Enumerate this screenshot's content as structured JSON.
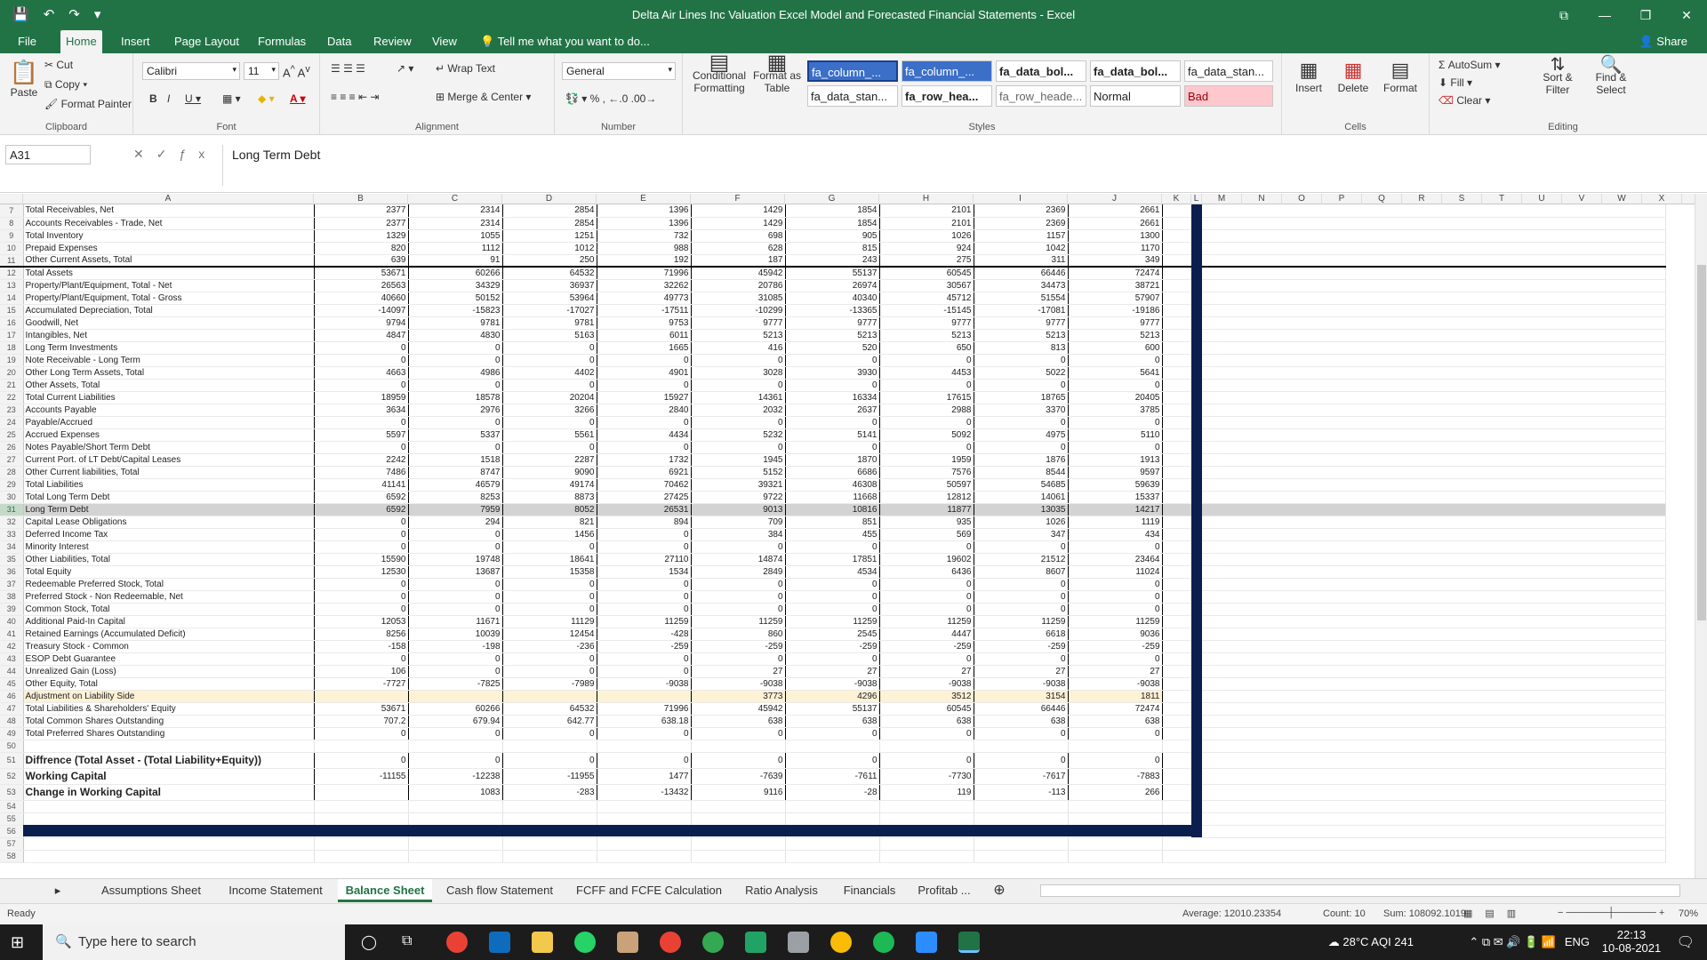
{
  "window": {
    "title": "Delta Air Lines Inc Valuation Excel Model and Forecasted Financial Statements - Excel",
    "buttons": [
      "⧉",
      "—",
      "❐",
      "✕"
    ]
  },
  "menu": {
    "tabs": [
      "File",
      "Home",
      "Insert",
      "Page Layout",
      "Formulas",
      "Data",
      "Review",
      "View"
    ],
    "tell_me": "Tell me what you want to do...",
    "share": "Share"
  },
  "ribbon": {
    "clipboard": {
      "label": "Clipboard",
      "paste": "Paste",
      "cut": "Cut",
      "copy": "Copy",
      "format_painter": "Format Painter"
    },
    "font": {
      "label": "Font",
      "name": "Calibri",
      "size": "11"
    },
    "alignment": {
      "label": "Alignment",
      "wrap": "Wrap Text",
      "merge": "Merge & Center"
    },
    "number": {
      "label": "Number",
      "format": "General"
    },
    "styles": {
      "label": "Styles",
      "conditional": "Conditional Formatting",
      "format_table": "Format as Table",
      "cells": [
        "fa_column_...",
        "fa_column_...",
        "fa_data_bol...",
        "fa_data_bol...",
        "fa_data_stan...",
        "fa_data_stan...",
        "fa_row_hea...",
        "fa_row_heade...",
        "Normal",
        "Bad"
      ]
    },
    "cells": {
      "label": "Cells",
      "insert": "Insert",
      "delete": "Delete",
      "format": "Format"
    },
    "editing": {
      "label": "Editing",
      "autosum": "AutoSum",
      "fill": "Fill",
      "clear": "Clear",
      "sort": "Sort & Filter",
      "find": "Find & Select"
    }
  },
  "formula_bar": {
    "name_box": "A31",
    "content": "Long Term Debt"
  },
  "columns": [
    "A",
    "B",
    "C",
    "D",
    "E",
    "F",
    "G",
    "H",
    "I",
    "J",
    "K",
    "L",
    "M",
    "N",
    "O",
    "P",
    "Q",
    "R",
    "S",
    "T",
    "U",
    "V",
    "W",
    "X"
  ],
  "rows": [
    {
      "n": "7",
      "label": "Total Receivables, Net",
      "v": [
        "2377",
        "2314",
        "2854",
        "1396",
        "1429",
        "1854",
        "2101",
        "2369",
        "2661"
      ]
    },
    {
      "n": "8",
      "label": "Accounts Receivables - Trade, Net",
      "v": [
        "2377",
        "2314",
        "2854",
        "1396",
        "1429",
        "1854",
        "2101",
        "2369",
        "2661"
      ]
    },
    {
      "n": "9",
      "label": "Total Inventory",
      "v": [
        "1329",
        "1055",
        "1251",
        "732",
        "698",
        "905",
        "1026",
        "1157",
        "1300"
      ]
    },
    {
      "n": "10",
      "label": "Prepaid Expenses",
      "v": [
        "820",
        "1112",
        "1012",
        "988",
        "628",
        "815",
        "924",
        "1042",
        "1170"
      ]
    },
    {
      "n": "11",
      "label": "Other Current Assets, Total",
      "v": [
        "639",
        "91",
        "250",
        "192",
        "187",
        "243",
        "275",
        "311",
        "349"
      ]
    },
    {
      "n": "12",
      "label": "Total Assets",
      "v": [
        "53671",
        "60266",
        "64532",
        "71996",
        "45942",
        "55137",
        "60545",
        "66446",
        "72474"
      ],
      "style": "thick"
    },
    {
      "n": "13",
      "label": "Property/Plant/Equipment, Total - Net",
      "v": [
        "26563",
        "34329",
        "36937",
        "32262",
        "20786",
        "26974",
        "30567",
        "34473",
        "38721"
      ]
    },
    {
      "n": "14",
      "label": "Property/Plant/Equipment, Total - Gross",
      "v": [
        "40660",
        "50152",
        "53964",
        "49773",
        "31085",
        "40340",
        "45712",
        "51554",
        "57907"
      ]
    },
    {
      "n": "15",
      "label": "Accumulated Depreciation, Total",
      "v": [
        "-14097",
        "-15823",
        "-17027",
        "-17511",
        "-10299",
        "-13365",
        "-15145",
        "-17081",
        "-19186"
      ]
    },
    {
      "n": "16",
      "label": "Goodwill, Net",
      "v": [
        "9794",
        "9781",
        "9781",
        "9753",
        "9777",
        "9777",
        "9777",
        "9777",
        "9777"
      ]
    },
    {
      "n": "17",
      "label": "Intangibles, Net",
      "v": [
        "4847",
        "4830",
        "5163",
        "6011",
        "5213",
        "5213",
        "5213",
        "5213",
        "5213"
      ]
    },
    {
      "n": "18",
      "label": "Long Term Investments",
      "v": [
        "0",
        "0",
        "0",
        "1665",
        "416",
        "520",
        "650",
        "813",
        "600"
      ]
    },
    {
      "n": "19",
      "label": "Note Receivable - Long Term",
      "v": [
        "0",
        "0",
        "0",
        "0",
        "0",
        "0",
        "0",
        "0",
        "0"
      ]
    },
    {
      "n": "20",
      "label": "Other Long Term Assets, Total",
      "v": [
        "4663",
        "4986",
        "4402",
        "4901",
        "3028",
        "3930",
        "4453",
        "5022",
        "5641"
      ]
    },
    {
      "n": "21",
      "label": "Other Assets, Total",
      "v": [
        "0",
        "0",
        "0",
        "0",
        "0",
        "0",
        "0",
        "0",
        "0"
      ]
    },
    {
      "n": "22",
      "label": "Total Current Liabilities",
      "v": [
        "18959",
        "18578",
        "20204",
        "15927",
        "14361",
        "16334",
        "17615",
        "18765",
        "20405"
      ]
    },
    {
      "n": "23",
      "label": "Accounts Payable",
      "v": [
        "3634",
        "2976",
        "3266",
        "2840",
        "2032",
        "2637",
        "2988",
        "3370",
        "3785"
      ]
    },
    {
      "n": "24",
      "label": "Payable/Accrued",
      "v": [
        "0",
        "0",
        "0",
        "0",
        "0",
        "0",
        "0",
        "0",
        "0"
      ]
    },
    {
      "n": "25",
      "label": "Accrued Expenses",
      "v": [
        "5597",
        "5337",
        "5561",
        "4434",
        "5232",
        "5141",
        "5092",
        "4975",
        "5110"
      ]
    },
    {
      "n": "26",
      "label": "Notes Payable/Short Term Debt",
      "v": [
        "0",
        "0",
        "0",
        "0",
        "0",
        "0",
        "0",
        "0",
        "0"
      ]
    },
    {
      "n": "27",
      "label": "Current Port. of LT Debt/Capital Leases",
      "v": [
        "2242",
        "1518",
        "2287",
        "1732",
        "1945",
        "1870",
        "1959",
        "1876",
        "1913"
      ]
    },
    {
      "n": "28",
      "label": "Other Current liabilities, Total",
      "v": [
        "7486",
        "8747",
        "9090",
        "6921",
        "5152",
        "6686",
        "7576",
        "8544",
        "9597"
      ]
    },
    {
      "n": "29",
      "label": "Total Liabilities",
      "v": [
        "41141",
        "46579",
        "49174",
        "70462",
        "39321",
        "46308",
        "50597",
        "54685",
        "59639"
      ]
    },
    {
      "n": "30",
      "label": "Total Long Term Debt",
      "v": [
        "6592",
        "8253",
        "8873",
        "27425",
        "9722",
        "11668",
        "12812",
        "14061",
        "15337"
      ]
    },
    {
      "n": "31",
      "label": "Long Term Debt",
      "v": [
        "6592",
        "7959",
        "8052",
        "26531",
        "9013",
        "10816",
        "11877",
        "13035",
        "14217"
      ],
      "style": "sel"
    },
    {
      "n": "32",
      "label": "Capital Lease Obligations",
      "v": [
        "0",
        "294",
        "821",
        "894",
        "709",
        "851",
        "935",
        "1026",
        "1119"
      ]
    },
    {
      "n": "33",
      "label": "Deferred Income Tax",
      "v": [
        "0",
        "0",
        "1456",
        "0",
        "384",
        "455",
        "569",
        "347",
        "434"
      ]
    },
    {
      "n": "34",
      "label": "Minority Interest",
      "v": [
        "0",
        "0",
        "0",
        "0",
        "0",
        "0",
        "0",
        "0",
        "0"
      ]
    },
    {
      "n": "35",
      "label": "Other Liabilities, Total",
      "v": [
        "15590",
        "19748",
        "18641",
        "27110",
        "14874",
        "17851",
        "19602",
        "21512",
        "23464"
      ]
    },
    {
      "n": "36",
      "label": "Total Equity",
      "v": [
        "12530",
        "13687",
        "15358",
        "1534",
        "2849",
        "4534",
        "6436",
        "8607",
        "11024"
      ]
    },
    {
      "n": "37",
      "label": "Redeemable Preferred Stock, Total",
      "v": [
        "0",
        "0",
        "0",
        "0",
        "0",
        "0",
        "0",
        "0",
        "0"
      ]
    },
    {
      "n": "38",
      "label": "Preferred Stock - Non Redeemable, Net",
      "v": [
        "0",
        "0",
        "0",
        "0",
        "0",
        "0",
        "0",
        "0",
        "0"
      ]
    },
    {
      "n": "39",
      "label": "Common Stock, Total",
      "v": [
        "0",
        "0",
        "0",
        "0",
        "0",
        "0",
        "0",
        "0",
        "0"
      ]
    },
    {
      "n": "40",
      "label": "Additional Paid-In Capital",
      "v": [
        "12053",
        "11671",
        "11129",
        "11259",
        "11259",
        "11259",
        "11259",
        "11259",
        "11259"
      ]
    },
    {
      "n": "41",
      "label": "Retained Earnings (Accumulated Deficit)",
      "v": [
        "8256",
        "10039",
        "12454",
        "-428",
        "860",
        "2545",
        "4447",
        "6618",
        "9036"
      ]
    },
    {
      "n": "42",
      "label": "Treasury Stock - Common",
      "v": [
        "-158",
        "-198",
        "-236",
        "-259",
        "-259",
        "-259",
        "-259",
        "-259",
        "-259"
      ]
    },
    {
      "n": "43",
      "label": "ESOP Debt Guarantee",
      "v": [
        "0",
        "0",
        "0",
        "0",
        "0",
        "0",
        "0",
        "0",
        "0"
      ]
    },
    {
      "n": "44",
      "label": "Unrealized Gain (Loss)",
      "v": [
        "106",
        "0",
        "0",
        "0",
        "27",
        "27",
        "27",
        "27",
        "27"
      ]
    },
    {
      "n": "45",
      "label": "Other Equity, Total",
      "v": [
        "-7727",
        "-7825",
        "-7989",
        "-9038",
        "-9038",
        "-9038",
        "-9038",
        "-9038",
        "-9038"
      ]
    },
    {
      "n": "46",
      "label": "Adjustment on Liability Side",
      "v": [
        "",
        "",
        "",
        "",
        "3773",
        "4296",
        "3512",
        "3154",
        "1811"
      ],
      "style": "hl"
    },
    {
      "n": "47",
      "label": "Total Liabilities & Shareholders' Equity",
      "v": [
        "53671",
        "60266",
        "64532",
        "71996",
        "45942",
        "55137",
        "60545",
        "66446",
        "72474"
      ]
    },
    {
      "n": "48",
      "label": "Total Common Shares Outstanding",
      "v": [
        "707.2",
        "679.94",
        "642.77",
        "638.18",
        "638",
        "638",
        "638",
        "638",
        "638"
      ]
    },
    {
      "n": "49",
      "label": "Total Preferred Shares Outstanding",
      "v": [
        "0",
        "0",
        "0",
        "0",
        "0",
        "0",
        "0",
        "0",
        "0"
      ]
    },
    {
      "n": "50",
      "label": "",
      "v": [
        "",
        "",
        "",
        "",
        "",
        "",
        "",
        "",
        ""
      ],
      "style": "blank"
    },
    {
      "n": "51",
      "label": "Diffrence (Total Asset - (Total Liability+Equity))",
      "v": [
        "0",
        "0",
        "0",
        "0",
        "0",
        "0",
        "0",
        "0",
        "0"
      ],
      "style": "bold"
    },
    {
      "n": "52",
      "label": "Working Capital",
      "v": [
        "-11155",
        "-12238",
        "-11955",
        "1477",
        "-7639",
        "-7611",
        "-7730",
        "-7617",
        "-7883"
      ],
      "style": "bold"
    },
    {
      "n": "53",
      "label": "Change in Working Capital",
      "v": [
        "",
        "1083",
        "-283",
        "-13432",
        "9116",
        "-28",
        "119",
        "-113",
        "266"
      ],
      "style": "bold"
    },
    {
      "n": "54",
      "label": "",
      "v": [
        "",
        "",
        "",
        "",
        "",
        "",
        "",
        "",
        ""
      ],
      "style": "blank"
    },
    {
      "n": "55",
      "label": "",
      "v": [
        "",
        "",
        "",
        "",
        "",
        "",
        "",
        "",
        ""
      ],
      "style": "blank"
    },
    {
      "n": "56",
      "label": "",
      "v": [
        "",
        "",
        "",
        "",
        "",
        "",
        "",
        "",
        ""
      ],
      "style": "blank"
    },
    {
      "n": "57",
      "label": "",
      "v": [
        "",
        "",
        "",
        "",
        "",
        "",
        "",
        "",
        ""
      ],
      "style": "blank"
    },
    {
      "n": "58",
      "label": "",
      "v": [
        "",
        "",
        "",
        "",
        "",
        "",
        "",
        "",
        ""
      ],
      "style": "blank"
    }
  ],
  "sheet_tabs": [
    "Assumptions Sheet",
    "Income Statement",
    "Balance Sheet",
    "Cash flow Statement",
    "FCFF and FCFE Calculation",
    "Ratio Analysis",
    "Financials",
    "Profitab ..."
  ],
  "active_sheet": "Balance Sheet",
  "status": {
    "ready": "Ready",
    "average": "Average: 12010.23354",
    "count": "Count: 10",
    "sum": "Sum: 108092.1019",
    "zoom": "70%"
  },
  "taskbar": {
    "search_placeholder": "Type here to search",
    "weather": "28°C  AQI 241",
    "lang": "ENG",
    "time": "22:13",
    "date": "10-08-2021"
  },
  "colors": {
    "excel_green": "#217346",
    "selection_row": "#d3d3d3",
    "highlight_row": "#fdf1d6",
    "border_navy": "#0b1f4f",
    "bad_style": "#ffc7ce"
  }
}
